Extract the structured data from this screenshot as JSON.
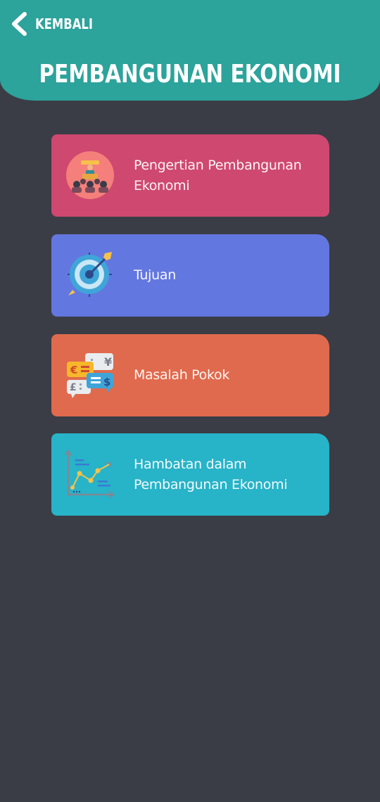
{
  "header": {
    "back_label": "KEMBALI",
    "back_icon": "chevron-left-icon",
    "title": "PEMBANGUNAN EKONOMI",
    "background": "#2ca39b"
  },
  "page_background": "#3a3d45",
  "menu": {
    "items": [
      {
        "label": "Pengertian Pembangunan Ekonomi",
        "color": "#cf4870",
        "icon": "presentation-audience-icon"
      },
      {
        "label": "Tujuan",
        "color": "#6377e0",
        "icon": "target-dart-icon"
      },
      {
        "label": "Masalah Pokok",
        "color": "#e06a4e",
        "icon": "currency-chat-icon"
      },
      {
        "label": "Hambatan dalam Pembangunan Ekonomi",
        "color": "#27b3c8",
        "icon": "growth-chart-icon"
      }
    ]
  }
}
